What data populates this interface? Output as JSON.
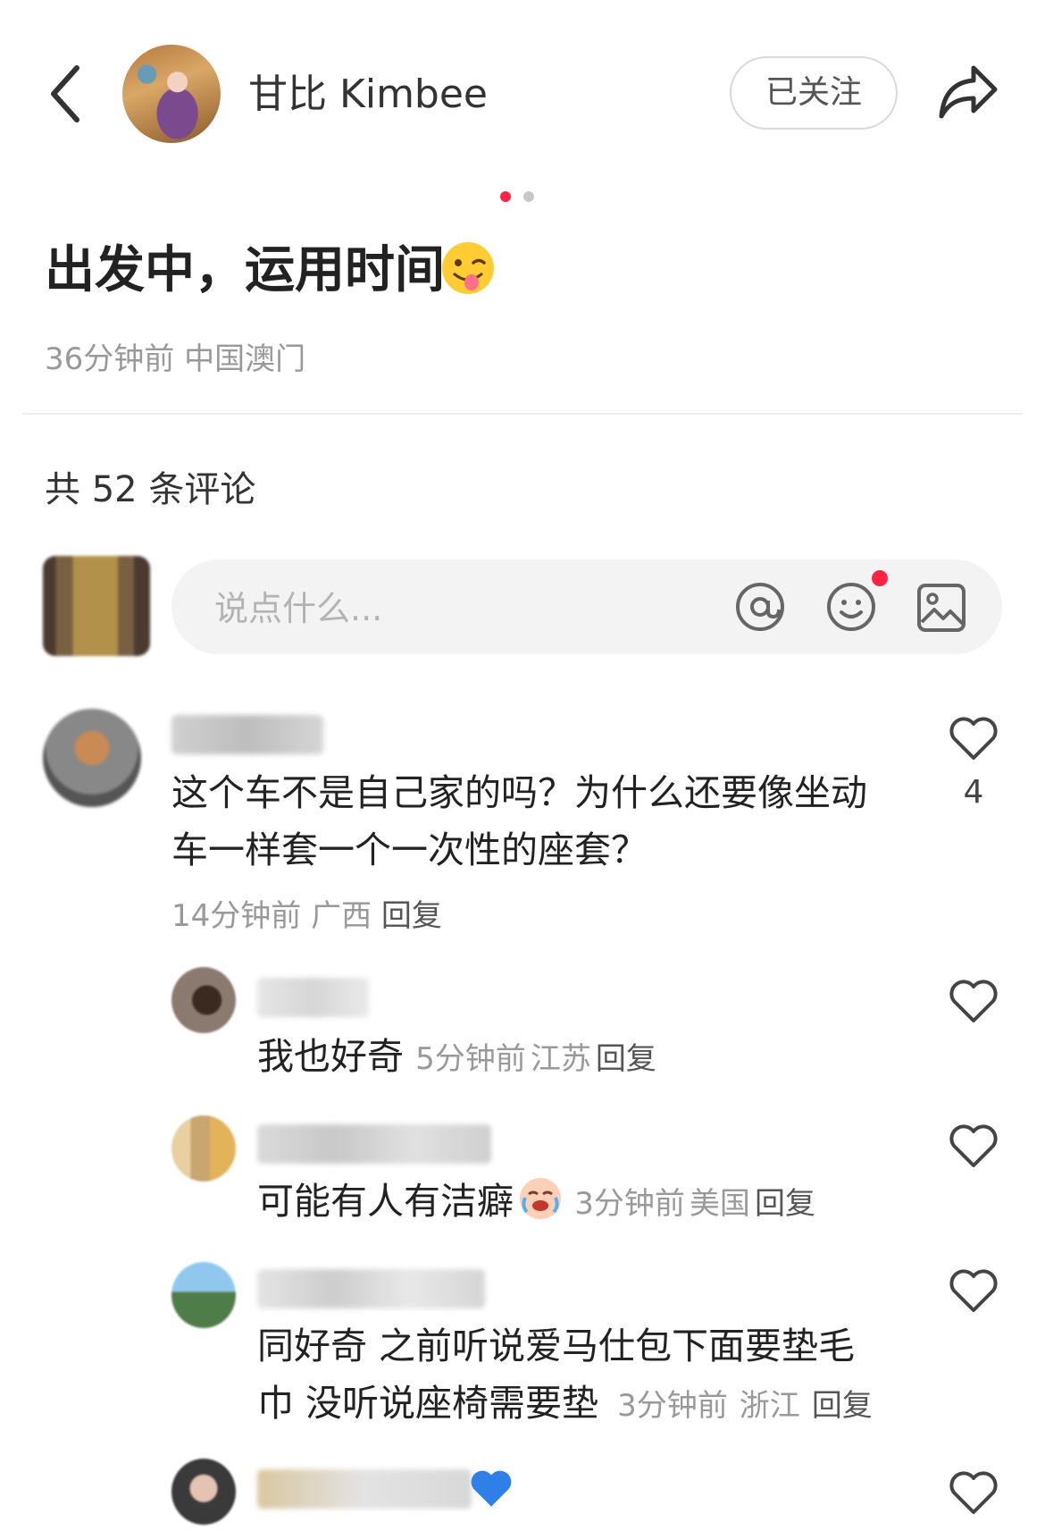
{
  "header": {
    "author_name": "甘比 Kimbee",
    "follow_label": "已关注"
  },
  "post": {
    "title": "出发中，运用时间",
    "time": "36分钟前",
    "location": "中国澳门",
    "carousel": {
      "total": 2,
      "active": 1
    }
  },
  "comments_header": {
    "count_label": "共 52 条评论"
  },
  "input": {
    "placeholder": "说点什么..."
  },
  "comments": [
    {
      "text_line1": "这个车不是自己家的吗？为什么还要像坐动",
      "text_line2": "车一样套一个一次性的座套？",
      "time": "14分钟前",
      "location": "广西",
      "reply": "回复",
      "likes": "4"
    }
  ],
  "replies": [
    {
      "text": "我也好奇",
      "time": "5分钟前",
      "location": "江苏",
      "reply": "回复"
    },
    {
      "text": "可能有人有洁癖",
      "time": "3分钟前",
      "location": "美国",
      "reply": "回复"
    },
    {
      "text_line1": "同好奇 之前听说爱马仕包下面要垫毛",
      "text_line2": "巾 没听说座椅需要垫",
      "time": "3分钟前",
      "location": "浙江",
      "reply": "回复"
    }
  ],
  "colors": {
    "accent": "#ff2442",
    "muted": "#999999"
  }
}
